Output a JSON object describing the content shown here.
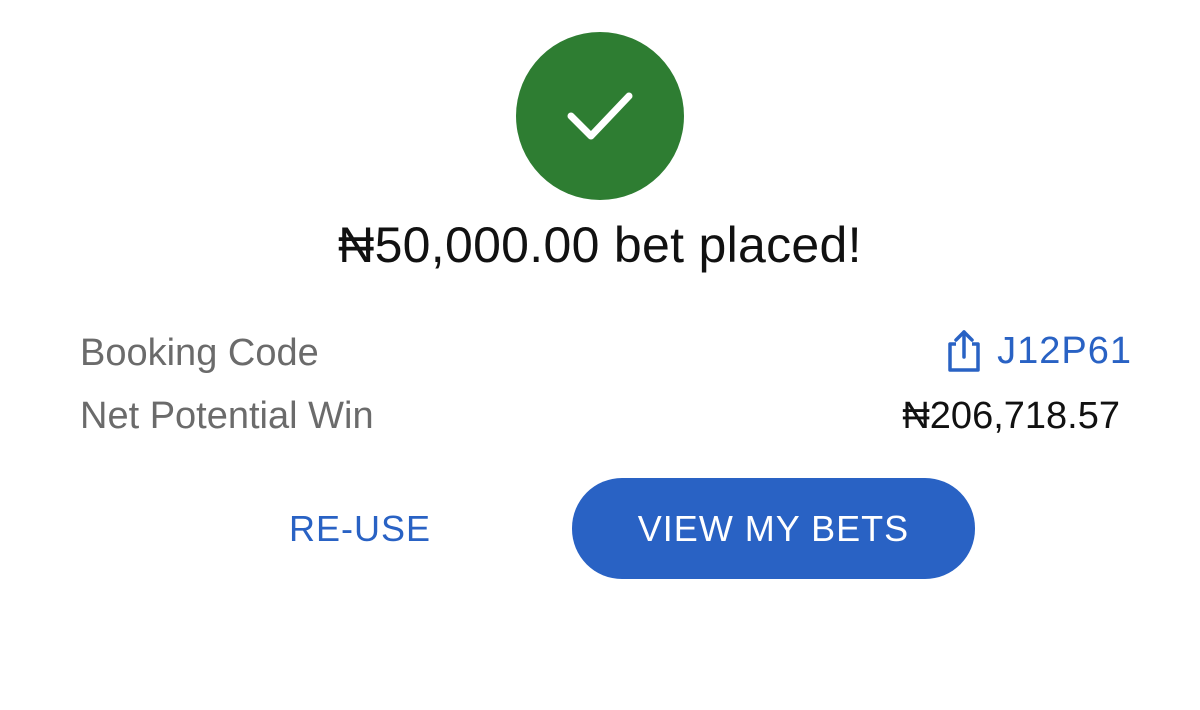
{
  "colors": {
    "success": "#2e7d32",
    "accent": "#2962c4",
    "text": "#111111",
    "muted": "#6b6b6b"
  },
  "status_icon": "check-icon",
  "headline": "₦50,000.00 bet placed!",
  "details": {
    "booking_code_label": "Booking Code",
    "booking_code_value": "J12P61",
    "booking_code_icon": "share-icon",
    "net_win_label": "Net Potential Win",
    "net_win_value": "₦206,718.57"
  },
  "actions": {
    "reuse_label": "RE-USE",
    "view_bets_label": "VIEW MY BETS"
  }
}
